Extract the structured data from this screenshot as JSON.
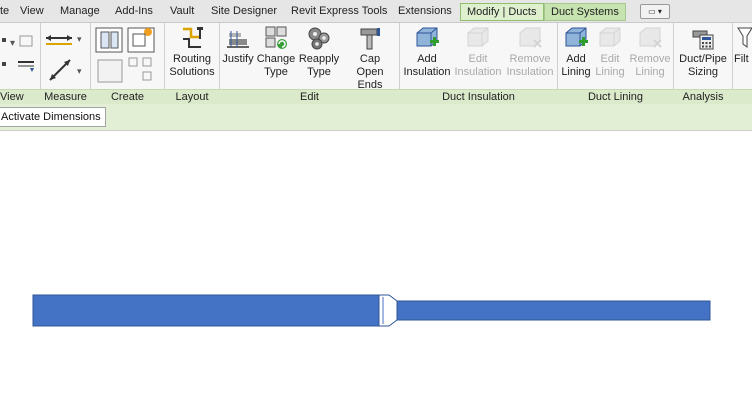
{
  "tabs": [
    {
      "label": "te",
      "active": false
    },
    {
      "label": "View",
      "active": false
    },
    {
      "label": "Manage",
      "active": false
    },
    {
      "label": "Add-Ins",
      "active": false
    },
    {
      "label": "Vault",
      "active": false
    },
    {
      "label": "Site Designer",
      "active": false
    },
    {
      "label": "Revit Express Tools",
      "active": false
    },
    {
      "label": "Extensions",
      "active": false
    },
    {
      "label": "Modify | Ducts",
      "active": true
    },
    {
      "label": "Duct Systems",
      "active": false
    }
  ],
  "ribbon": {
    "groups": [
      {
        "label": "View"
      },
      {
        "label": "Measure"
      },
      {
        "label": "Create"
      },
      {
        "label": "Layout"
      },
      {
        "label": "Edit"
      },
      {
        "label": "Duct Insulation"
      },
      {
        "label": "Duct Lining"
      },
      {
        "label": "Analysis"
      }
    ],
    "buttons": {
      "routing_solutions": {
        "line1": "Routing",
        "line2": "Solutions"
      },
      "justify": {
        "line1": "Justify",
        "line2": ""
      },
      "change_type": {
        "line1": "Change",
        "line2": "Type"
      },
      "reapply_type": {
        "line1": "Reapply",
        "line2": "Type"
      },
      "cap_open_ends": {
        "line1": "Cap",
        "line2": "Open Ends"
      },
      "add_insulation": {
        "line1": "Add",
        "line2": "Insulation"
      },
      "edit_insulation": {
        "line1": "Edit",
        "line2": "Insulation"
      },
      "remove_insulation": {
        "line1": "Remove",
        "line2": "Insulation"
      },
      "add_lining": {
        "line1": "Add",
        "line2": "Lining"
      },
      "edit_lining": {
        "line1": "Edit",
        "line2": "Lining"
      },
      "remove_lining": {
        "line1": "Remove",
        "line2": "Lining"
      },
      "duct_pipe_sizing": {
        "line1": "Duct/Pipe",
        "line2": "Sizing"
      },
      "filter": {
        "line1": "Filt",
        "line2": ""
      }
    }
  },
  "options_bar": {
    "activate_dimensions": "Activate Dimensions"
  },
  "colors": {
    "duct_fill": "#4472c4",
    "duct_stroke": "#2f5597",
    "context_tab": "#c6e3b0",
    "group_bar": "#dbeacb"
  }
}
